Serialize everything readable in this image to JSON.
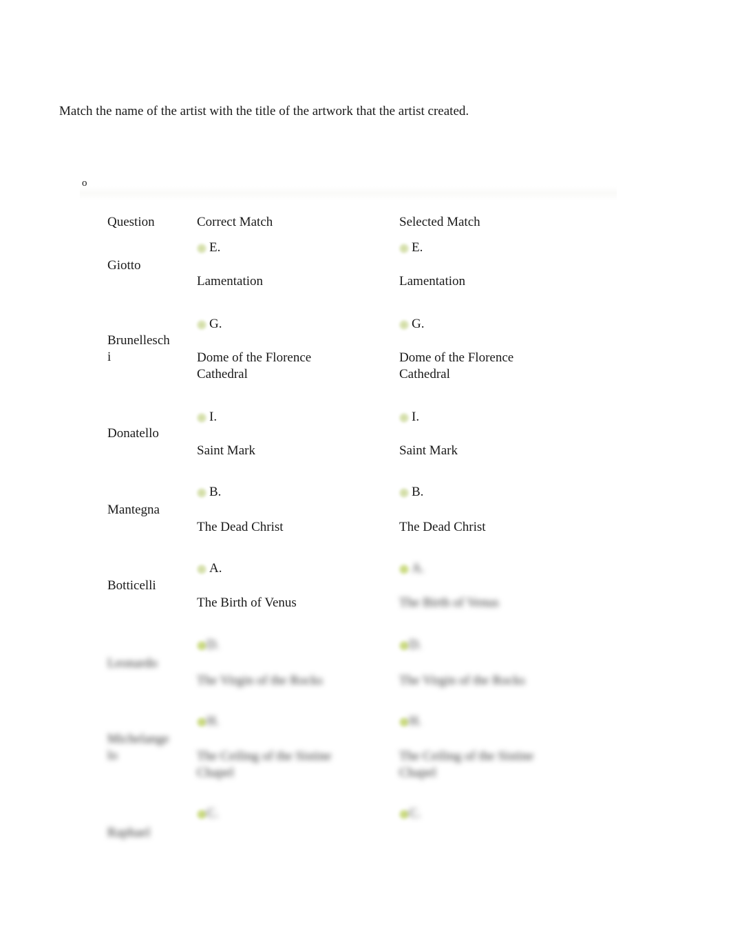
{
  "question": {
    "prompt": "Match the name of the artist with the title of the artwork that the artist created.",
    "bullet": "o"
  },
  "table": {
    "headers": {
      "question": "Question",
      "correct": "Correct Match",
      "selected": "Selected Match"
    },
    "rows": [
      {
        "artist": "Giotto",
        "correct_letter": "E.",
        "correct_title": "Lamentation",
        "selected_letter": "E.",
        "selected_title": "Lamentation"
      },
      {
        "artist": "Brunelleschi",
        "correct_letter": "G.",
        "correct_title": "Dome of the Florence Cathedral",
        "selected_letter": "G.",
        "selected_title": "Dome of the Florence Cathedral"
      },
      {
        "artist": "Donatello",
        "correct_letter": "I.",
        "correct_title": "Saint Mark",
        "selected_letter": "I.",
        "selected_title": "Saint Mark"
      },
      {
        "artist": "Mantegna",
        "correct_letter": "B.",
        "correct_title": "The Dead Christ",
        "selected_letter": "B.",
        "selected_title": "The Dead Christ"
      },
      {
        "artist": "Botticelli",
        "correct_letter": "A.",
        "correct_title": "The Birth of Venus",
        "selected_letter": "A.",
        "selected_title": "The Birth of Venus"
      },
      {
        "artist": "Leonardo",
        "correct_letter": "D.",
        "correct_title": "The Virgin of the Rocks",
        "selected_letter": "D.",
        "selected_title": "The Virgin of the Rocks"
      },
      {
        "artist": "Michelangelo",
        "correct_letter": "H.",
        "correct_title": "The Ceiling of the Sistine Chapel",
        "selected_letter": "H.",
        "selected_title": "The Ceiling of the Sistine Chapel"
      },
      {
        "artist": "Raphael",
        "correct_letter": "C.",
        "correct_title": "",
        "selected_letter": "C.",
        "selected_title": ""
      }
    ]
  }
}
